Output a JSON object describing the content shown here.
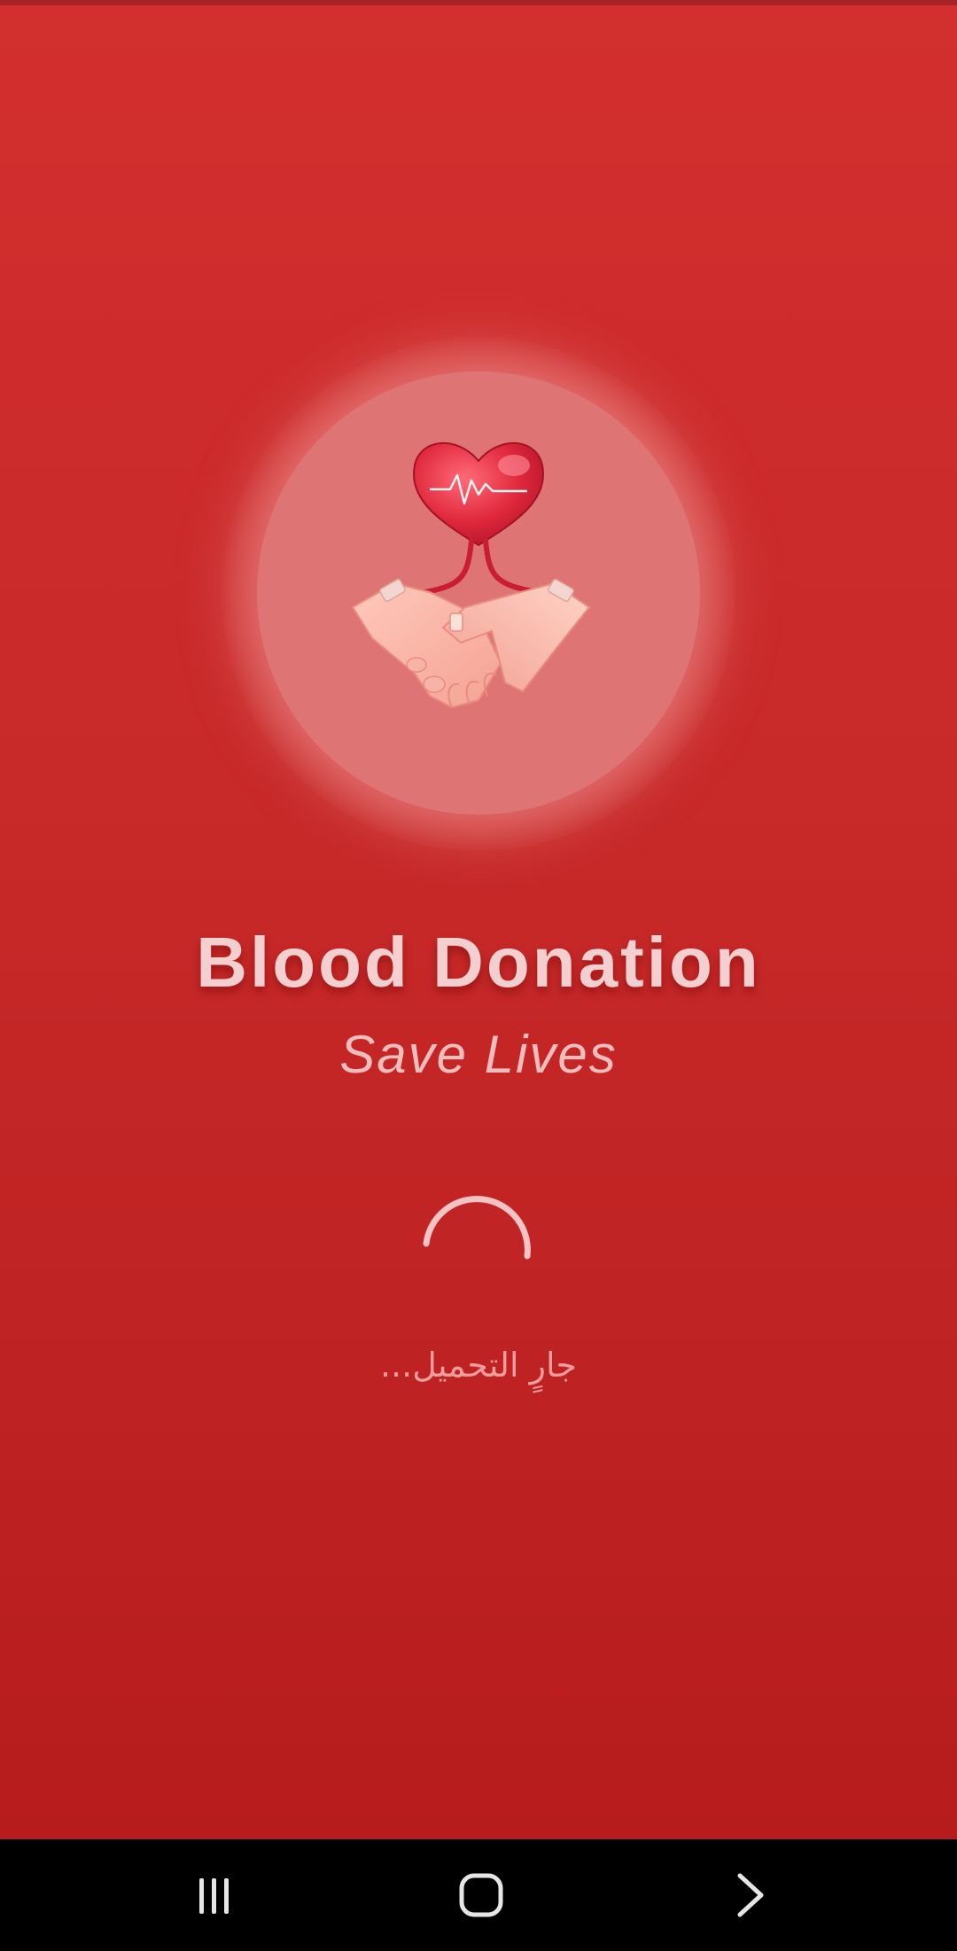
{
  "splash": {
    "title": "Blood Donation",
    "subtitle": "Save Lives",
    "loading_text": "جارٍ التحميل...",
    "logo_icon": "heart-handshake-icon",
    "spinner_icon": "loading-spinner-icon"
  },
  "nav_bar": {
    "recents_icon": "recent-apps-icon",
    "home_icon": "home-icon",
    "back_icon": "back-chevron-icon"
  },
  "colors": {
    "background_top": "#d32f2f",
    "background_bottom": "#b71c1c",
    "logo_circle": "#de7474",
    "title_text": "#f3cfcf",
    "nav_bar": "#000000"
  }
}
